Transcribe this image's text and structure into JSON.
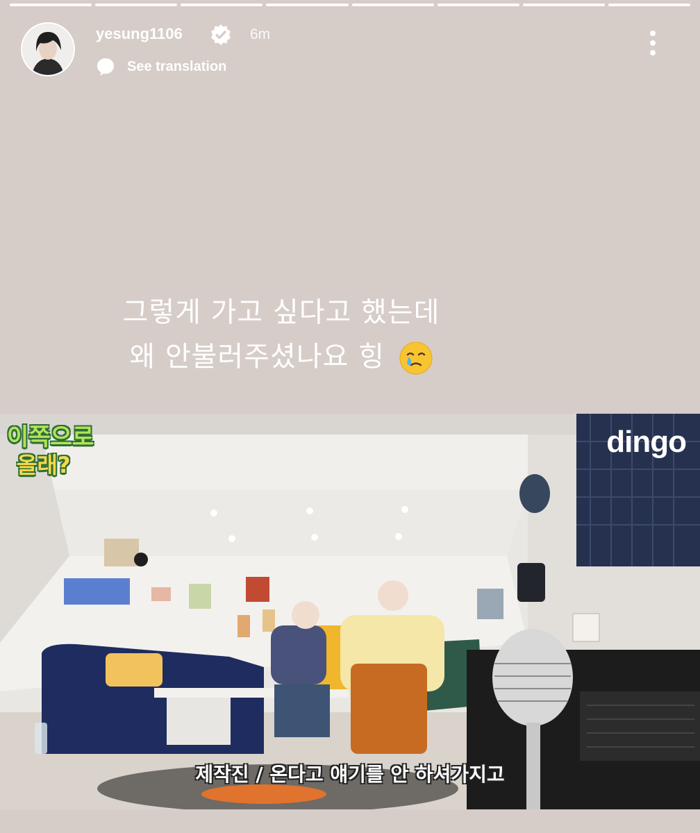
{
  "story": {
    "segments_total": 8,
    "username": "yesung1106",
    "verified": true,
    "time_ago": "6m",
    "see_translation": "See translation",
    "icons": {
      "verified": "verified-badge-icon",
      "translate": "speech-bubble-icon",
      "more": "more-options-icon",
      "emoji": "face-holding-back-tears-emoji"
    }
  },
  "caption": {
    "line1": "그렇게 가고 싶다고 했는데",
    "line2": "왜 안불러주셨나요 힝"
  },
  "video": {
    "show_logo_line1": "이쪽으로",
    "show_logo_line2": "올래?",
    "brand": "dingo",
    "subtitle": "제작진 / 온다고 얘기를 안 하셔가지고"
  },
  "colors": {
    "background": "#d6ccc8",
    "text": "#ffffff",
    "sofa": "#2f3b6b",
    "chair": "#2f5a4a"
  }
}
